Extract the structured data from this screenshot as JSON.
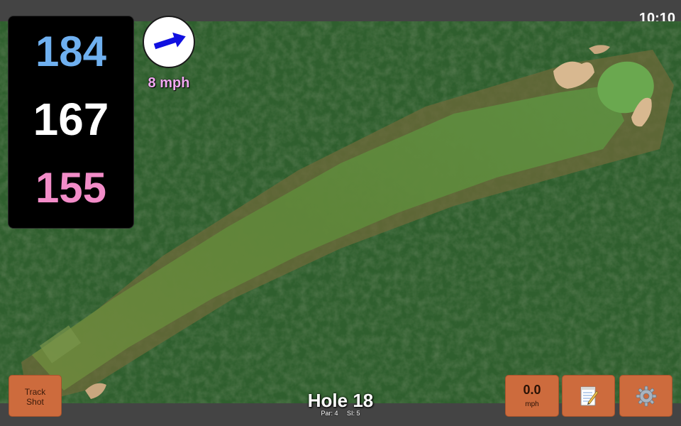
{
  "status": {
    "time": "10:10"
  },
  "distances": {
    "back": "184",
    "middle": "167",
    "front": "155",
    "colors": {
      "back": "#6fb0f0",
      "middle": "#ffffff",
      "front": "#f28cc8"
    }
  },
  "wind": {
    "speed": "8 mph",
    "icon": "wind-arrow-icon",
    "arrow_color": "#1010e0"
  },
  "buttons": {
    "track_shot": {
      "line1": "Track",
      "line2": "Shot"
    },
    "speed": {
      "value": "0.0",
      "unit": "mph"
    },
    "notes": {
      "icon": "notepad-icon"
    },
    "settings": {
      "icon": "gear-icon"
    }
  },
  "hole": {
    "title": "Hole 18",
    "par": "Par: 4",
    "si": "SI: 5"
  },
  "theme": {
    "button_color": "#cd6b3d",
    "bar_color": "#444444"
  }
}
